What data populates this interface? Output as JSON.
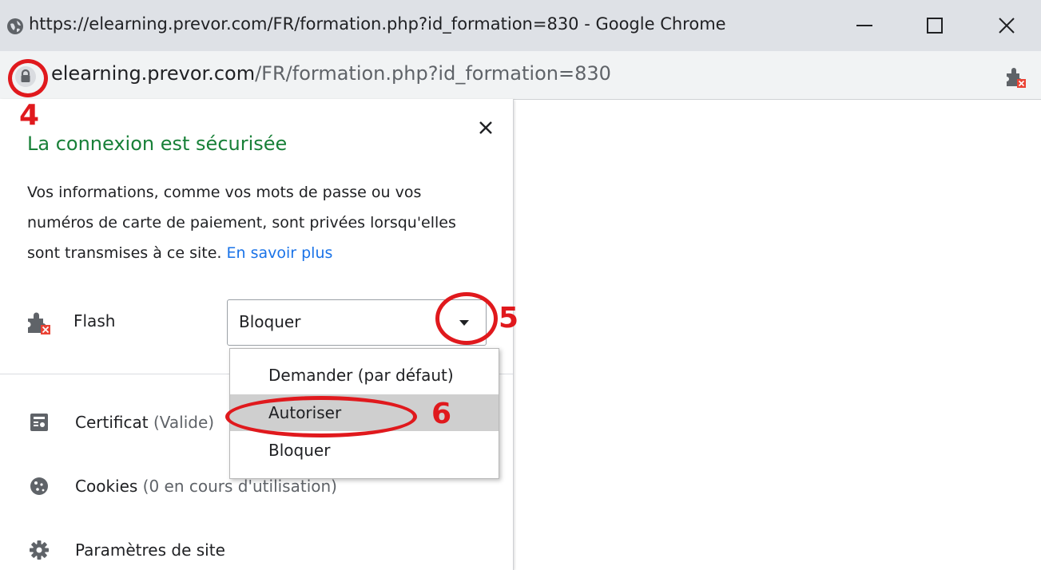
{
  "window": {
    "title": "https://elearning.prevor.com/FR/formation.php?id_formation=830 - Google Chrome"
  },
  "address_bar": {
    "host": "elearning.prevor.com",
    "path": "/FR/formation.php?id_formation=830"
  },
  "popup": {
    "title": "La connexion est sécurisée",
    "description": "Vos informations, comme vos mots de passe ou vos numéros de carte de paiement, sont privées lorsqu'elles sont transmises à ce site.",
    "learn_more": "En savoir plus",
    "flash": {
      "label": "Flash",
      "selected": "Bloquer",
      "options": [
        "Demander (par défaut)",
        "Autoriser",
        "Bloquer"
      ],
      "highlighted_option": "Autoriser"
    },
    "certificate": {
      "label": "Certificat",
      "status": "(Valide)"
    },
    "cookies": {
      "label": "Cookies",
      "status": "(0 en cours d'utilisation)"
    },
    "site_settings": {
      "label": "Paramètres de site"
    }
  },
  "annotations": {
    "step4": "4",
    "step5": "5",
    "step6": "6",
    "color": "#e0191d"
  },
  "colors": {
    "secure_green": "#188038",
    "link_blue": "#1a73e8",
    "titlebar": "#dee1e6",
    "addressbar": "#f1f3f4"
  },
  "icons": {
    "title": "globe-icon",
    "lock": "lock-icon",
    "extension": "blocked-plugin-icon",
    "close": "close-icon",
    "certificate": "certificate-icon",
    "cookies": "cookie-icon",
    "settings": "gear-icon"
  }
}
